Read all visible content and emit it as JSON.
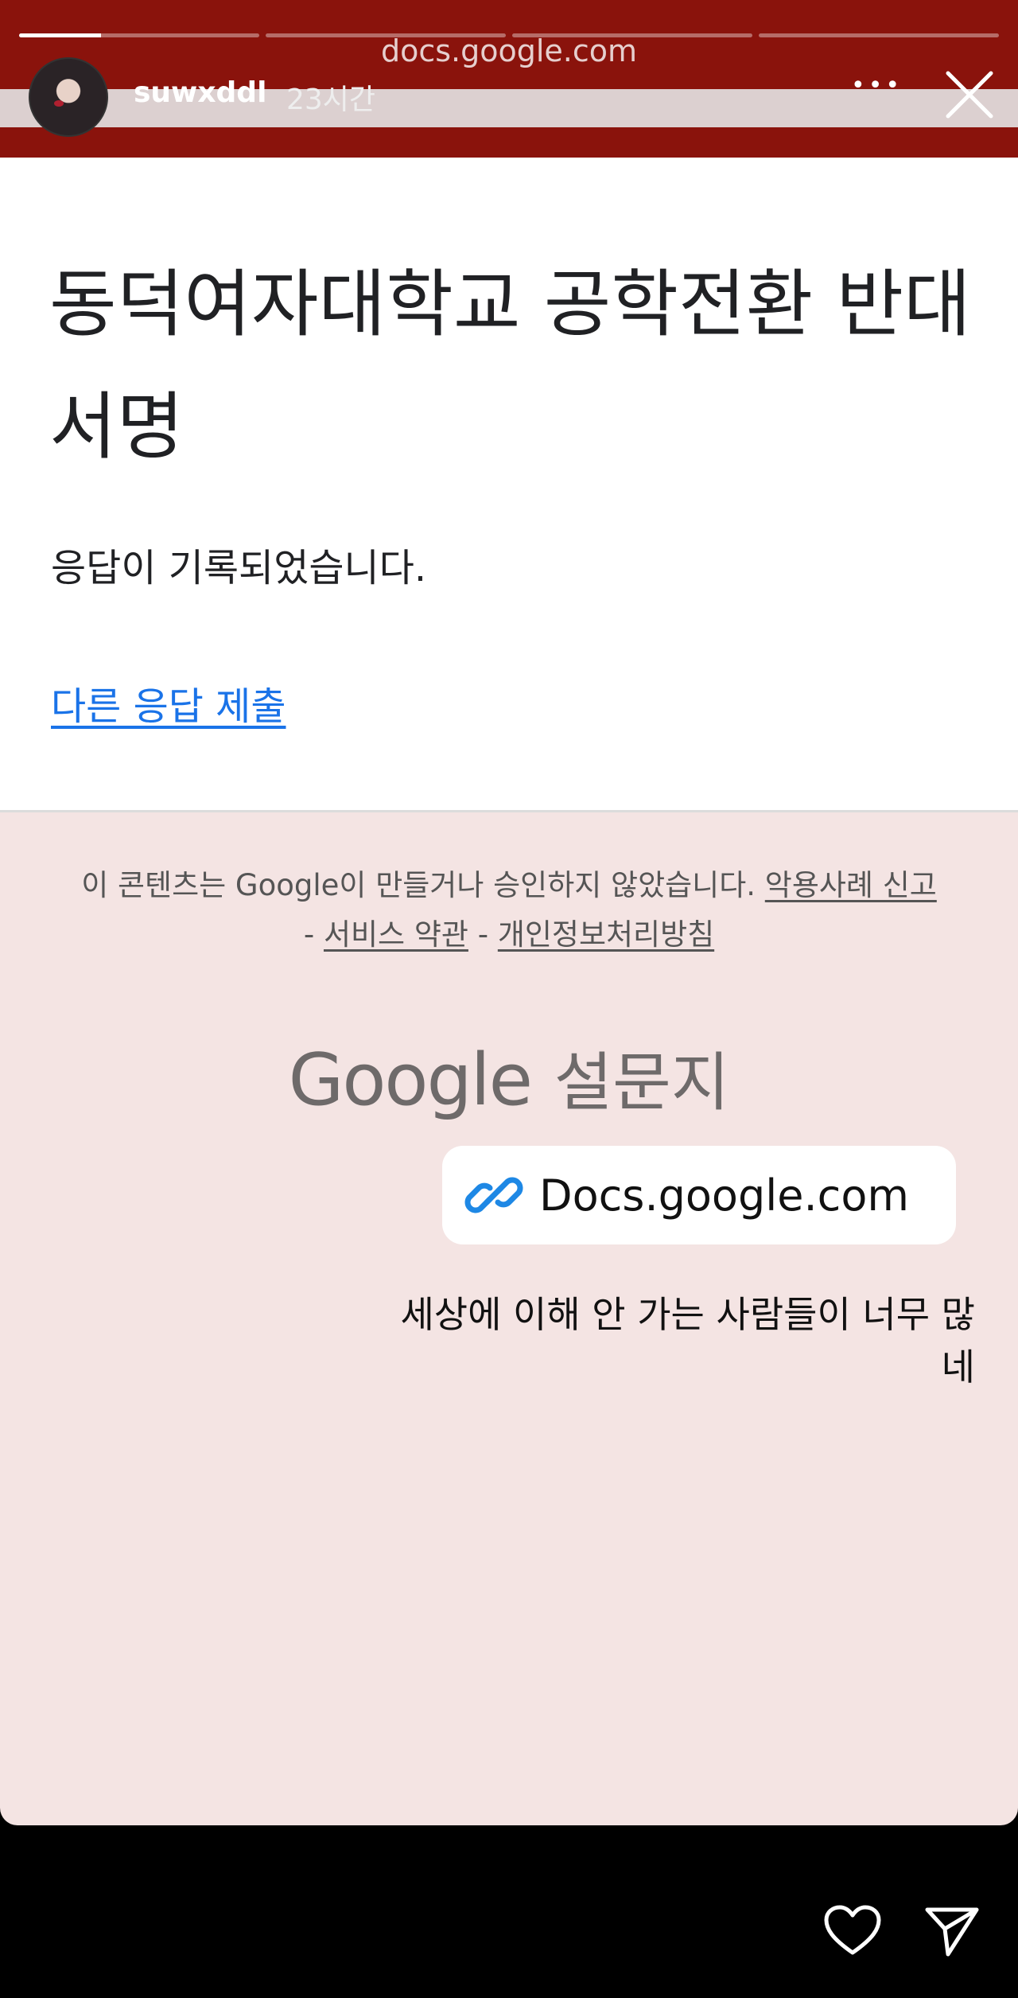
{
  "story": {
    "url": "docs.google.com",
    "username": "suwxddl",
    "time": "23시간",
    "progress_segments": [
      0.34,
      0,
      0,
      0
    ]
  },
  "form": {
    "title": "동덕여자대학교 공학전환 반대 서명",
    "message": "응답이 기록되었습니다.",
    "link": "다른 응답 제출"
  },
  "footer": {
    "disclaimer": "이 콘텐츠는 Google이 만들거나 승인하지 않았습니다.",
    "report_link": "악용사례 신고",
    "sep": "-",
    "terms_link": "서비스 약관",
    "privacy_link": "개인정보처리방침",
    "brand_google": "Google",
    "brand_forms": "설문지"
  },
  "sticker": {
    "link_text": "Docs.google.com",
    "caption": "세상에 이해 안 가는 사람들이 너무 많네"
  },
  "colors": {
    "top_bar": "#8a130c",
    "background": "#f4e4e3",
    "link": "#1a73e8",
    "link_icon": "#1e88e5"
  },
  "icons": {
    "like": "heart-icon",
    "share": "send-icon",
    "close": "close-icon",
    "more": "more-icon",
    "link": "link-icon"
  }
}
